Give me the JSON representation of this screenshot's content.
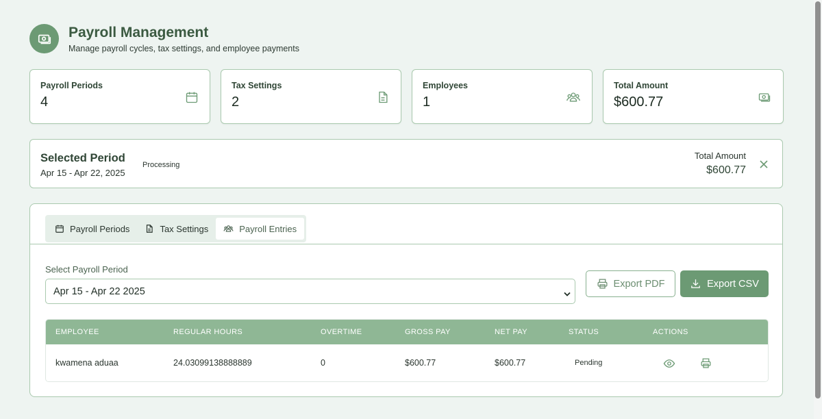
{
  "header": {
    "icon": "money-icon",
    "title": "Payroll Management",
    "subtitle": "Manage payroll cycles, tax settings, and employee payments"
  },
  "stats": [
    {
      "label": "Payroll Periods",
      "value": "4",
      "icon": "calendar-icon"
    },
    {
      "label": "Tax Settings",
      "value": "2",
      "icon": "document-icon"
    },
    {
      "label": "Employees",
      "value": "1",
      "icon": "users-icon"
    },
    {
      "label": "Total Amount",
      "value": "$600.77",
      "icon": "money-icon"
    }
  ],
  "selected_period": {
    "title": "Selected Period",
    "range": "Apr 15 - Apr 22, 2025",
    "status": "Processing",
    "total_label": "Total Amount",
    "total_value": "$600.77"
  },
  "tabs": [
    {
      "label": "Payroll Periods",
      "icon": "calendar-icon",
      "active": false
    },
    {
      "label": "Tax Settings",
      "icon": "document-icon",
      "active": false
    },
    {
      "label": "Payroll Entries",
      "icon": "users-icon",
      "active": true
    }
  ],
  "entries": {
    "select_label": "Select Payroll Period",
    "select_value": "Apr 15 - Apr 22 2025",
    "export_pdf_label": "Export PDF",
    "export_csv_label": "Export CSV",
    "columns": [
      "EMPLOYEE",
      "REGULAR HOURS",
      "OVERTIME",
      "GROSS PAY",
      "NET PAY",
      "STATUS",
      "ACTIONS"
    ],
    "rows": [
      {
        "employee": "kwamena aduaa",
        "regular_hours": "24.03099138888889",
        "overtime": "0",
        "gross_pay": "$600.77",
        "net_pay": "$600.77",
        "status": "Pending"
      }
    ]
  },
  "colors": {
    "accent": "#6c9a74",
    "table_header": "#8fb795",
    "border": "#a9c9ae",
    "background": "#eef4f1"
  }
}
